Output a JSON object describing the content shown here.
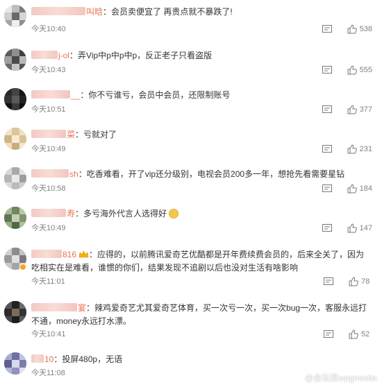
{
  "colors": {
    "name": "#eb7350",
    "text": "#333333",
    "meta": "#808080"
  },
  "comments": [
    {
      "name": "叫晗",
      "text": "会员卖便宜了 再贵点就不暴跌了!",
      "time": "今天10:40",
      "likes": "538"
    },
    {
      "name": "j-ol",
      "text": "弄Vip中p中p中p，反正老子只看盗版",
      "time": "今天10:43",
      "likes": "555"
    },
    {
      "name": "__",
      "text": "你不亏谁亏，会员中会员，还限制账号",
      "time": "今天10:51",
      "likes": "377"
    },
    {
      "name": "菜",
      "text": "亏就对了",
      "time": "今天10:49",
      "likes": "231"
    },
    {
      "name": "sh",
      "text": "吃香难看，开了vip还分级别，电视会员200多一年，想抢先看需要星钻",
      "time": "今天10:58",
      "likes": "184"
    },
    {
      "name": "寿",
      "text": "多亏海外代言人选得好",
      "time": "今天10:49",
      "likes": "147"
    },
    {
      "name": "816",
      "text": "应得的，以前腾讯爱奇艺优酷都是开年费续费会员的，后来全关了，因为吃相实在是难看，谁惯的你们，结果发现不追剧以后也没对生活有啥影响",
      "time": "今天11:01",
      "likes": "78"
    },
    {
      "name": "宴",
      "text": "辣鸡爱奇艺尤其爱奇艺体育，买一次亏一次，买一次bug一次，客服永远打不通，money永远打水漂。",
      "time": "今天10:41",
      "likes": "52"
    },
    {
      "name": "10",
      "text": "投屏480p，无语",
      "time": "今天11:08",
      "likes": ""
    }
  ],
  "watermark": {
    "text": "@会玩君wpgmedia"
  }
}
